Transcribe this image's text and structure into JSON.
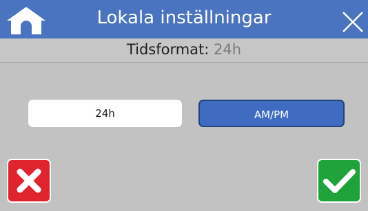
{
  "header": {
    "title": "Lokala inställningar",
    "home_icon": "home-icon",
    "close_icon": "close-icon"
  },
  "setting": {
    "label": "Tidsformat:",
    "value": "24h"
  },
  "options": [
    {
      "label": "24h",
      "selected": false
    },
    {
      "label": "AM/PM",
      "selected": true
    }
  ],
  "actions": {
    "cancel_icon": "x-icon",
    "confirm_icon": "checkmark-icon"
  },
  "colors": {
    "header": "#4a73c0",
    "background": "#c2c2c2",
    "selected_option": "#3f6cc0",
    "cancel": "#e0242e",
    "confirm": "#1fa23a"
  }
}
